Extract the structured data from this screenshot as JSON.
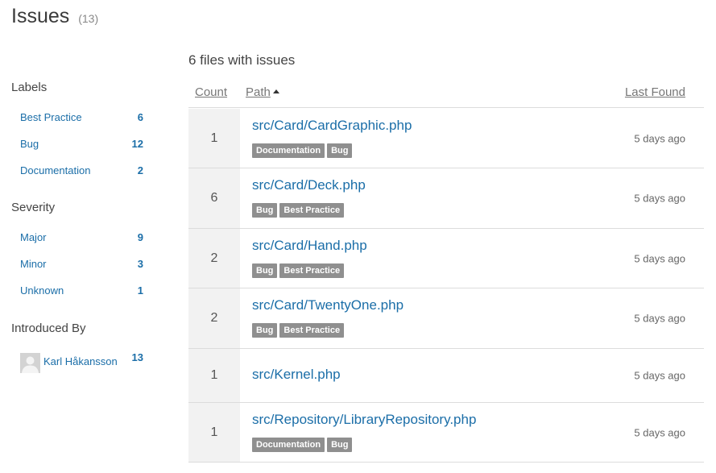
{
  "header": {
    "title": "Issues",
    "count": "(13)"
  },
  "sidebar": {
    "labels": {
      "title": "Labels",
      "items": [
        {
          "label": "Best Practice",
          "count": "6"
        },
        {
          "label": "Bug",
          "count": "12"
        },
        {
          "label": "Documentation",
          "count": "2"
        }
      ]
    },
    "severity": {
      "title": "Severity",
      "items": [
        {
          "label": "Major",
          "count": "9"
        },
        {
          "label": "Minor",
          "count": "3"
        },
        {
          "label": "Unknown",
          "count": "1"
        }
      ]
    },
    "introduced_by": {
      "title": "Introduced By",
      "items": [
        {
          "label": "Karl Håkansson",
          "count": "13",
          "icon": "avatar-placeholder-icon"
        }
      ]
    }
  },
  "main": {
    "summary": "6 files with issues",
    "columns": {
      "count": "Count",
      "path": "Path",
      "last_found": "Last Found"
    },
    "rows": [
      {
        "count": "1",
        "path": "src/Card/CardGraphic.php",
        "tags": [
          "Documentation",
          "Bug"
        ],
        "last_found": "5 days ago"
      },
      {
        "count": "6",
        "path": "src/Card/Deck.php",
        "tags": [
          "Bug",
          "Best Practice"
        ],
        "last_found": "5 days ago"
      },
      {
        "count": "2",
        "path": "src/Card/Hand.php",
        "tags": [
          "Bug",
          "Best Practice"
        ],
        "last_found": "5 days ago"
      },
      {
        "count": "2",
        "path": "src/Card/TwentyOne.php",
        "tags": [
          "Bug",
          "Best Practice"
        ],
        "last_found": "5 days ago"
      },
      {
        "count": "1",
        "path": "src/Kernel.php",
        "tags": [],
        "last_found": "5 days ago"
      },
      {
        "count": "1",
        "path": "src/Repository/LibraryRepository.php",
        "tags": [
          "Documentation",
          "Bug"
        ],
        "last_found": "5 days ago"
      }
    ]
  },
  "colors": {
    "link": "#1b6ea8",
    "tag_bg": "#8f8f8f",
    "count_cell_bg": "#f2f2f2",
    "divider": "#dcdcdc"
  }
}
